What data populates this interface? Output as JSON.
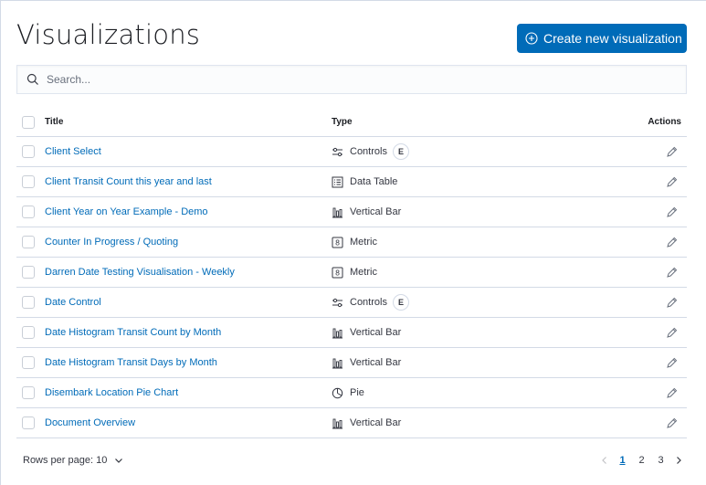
{
  "page": {
    "title": "Visualizations"
  },
  "toolbar": {
    "create_label": "Create new visualization"
  },
  "search": {
    "placeholder": "Search..."
  },
  "table": {
    "columns": {
      "title": "Title",
      "type": "Type",
      "actions": "Actions"
    },
    "rows": [
      {
        "title": "Client Select",
        "type": "Controls",
        "type_icon": "controls-icon",
        "badge": "E"
      },
      {
        "title": "Client Transit Count this year and last",
        "type": "Data Table",
        "type_icon": "table-icon",
        "badge": ""
      },
      {
        "title": "Client Year on Year Example - Demo",
        "type": "Vertical Bar",
        "type_icon": "bar-chart-icon",
        "badge": ""
      },
      {
        "title": "Counter In Progress / Quoting",
        "type": "Metric",
        "type_icon": "metric-icon",
        "badge": ""
      },
      {
        "title": "Darren Date Testing Visualisation - Weekly",
        "type": "Metric",
        "type_icon": "metric-icon",
        "badge": ""
      },
      {
        "title": "Date Control",
        "type": "Controls",
        "type_icon": "controls-icon",
        "badge": "E"
      },
      {
        "title": "Date Histogram Transit Count by Month",
        "type": "Vertical Bar",
        "type_icon": "bar-chart-icon",
        "badge": ""
      },
      {
        "title": "Date Histogram Transit Days by Month",
        "type": "Vertical Bar",
        "type_icon": "bar-chart-icon",
        "badge": ""
      },
      {
        "title": "Disembark Location Pie Chart",
        "type": "Pie",
        "type_icon": "pie-icon",
        "badge": ""
      },
      {
        "title": "Document Overview",
        "type": "Vertical Bar",
        "type_icon": "bar-chart-icon",
        "badge": ""
      }
    ]
  },
  "footer": {
    "rows_per_page": "Rows per page: 10",
    "pages": [
      "1",
      "2",
      "3"
    ],
    "current_page": "1"
  },
  "colors": {
    "accent": "#006bb8",
    "border": "#d3dae6",
    "text": "#343741"
  }
}
